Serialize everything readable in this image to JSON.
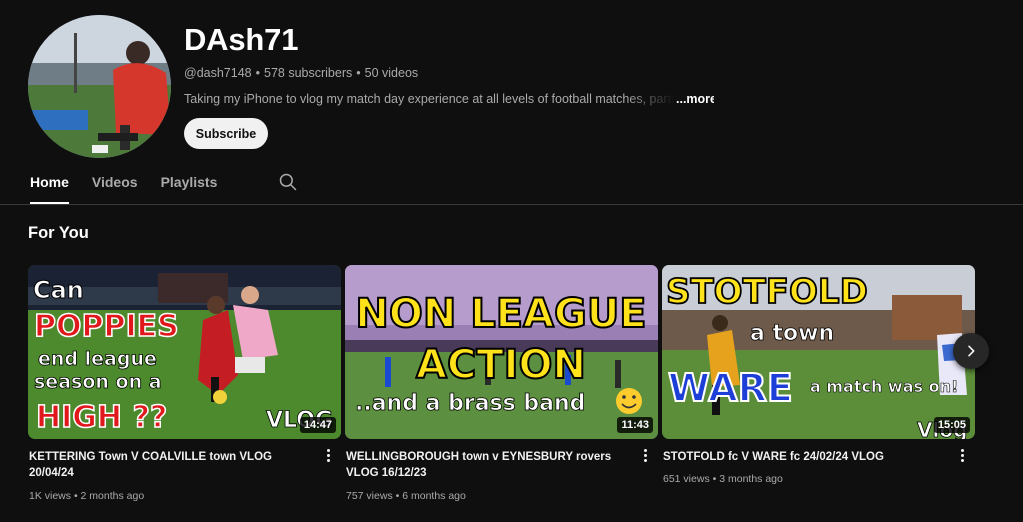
{
  "channel": {
    "name": "DAsh71",
    "handle": "@dash7148",
    "subscribers": "578 subscribers",
    "videos_count": "50 videos",
    "separator": "•",
    "description": "Taking my iPhone to vlog my match day experience at all levels of football matches, parti",
    "more_label": "...more",
    "subscribe_label": "Subscribe"
  },
  "tabs": [
    {
      "label": "Home",
      "active": true
    },
    {
      "label": "Videos",
      "active": false
    },
    {
      "label": "Playlists",
      "active": false
    }
  ],
  "section": {
    "title": "For You"
  },
  "videos": [
    {
      "title": "KETTERING Town V COALVILLE town VLOG 20/04/24",
      "views": "1K views",
      "age": "2 months ago",
      "duration": "14:47",
      "thumb_text": [
        "Can",
        "POPPIES",
        "end league",
        "season on a",
        "HIGH ??",
        "VLOG"
      ]
    },
    {
      "title": "WELLINGBOROUGH town v EYNESBURY rovers VLOG 16/12/23",
      "views": "757 views",
      "age": "6 months ago",
      "duration": "11:43",
      "thumb_text": [
        "NON LEAGUE",
        "ACTION",
        "..and a brass band"
      ]
    },
    {
      "title": "STOTFOLD fc V WARE fc 24/02/24 VLOG",
      "views": "651 views",
      "age": "3 months ago",
      "duration": "15:05",
      "thumb_text": [
        "STOTFOLD",
        "a town",
        "WARE",
        "a match was on!",
        "Vlog"
      ]
    }
  ],
  "icons": {
    "search": "search-icon",
    "more": "more-vert-icon",
    "next": "chevron-right-icon"
  },
  "colors": {
    "background": "#0f0f0f",
    "text_primary": "#f1f1f1",
    "text_secondary": "#aaaaaa",
    "subscribe_bg": "#f1f1f1",
    "thumb_red_text": "#e0181b",
    "thumb_yellow_text": "#ffe21a",
    "thumb_blue_text": "#1d3fd8"
  }
}
